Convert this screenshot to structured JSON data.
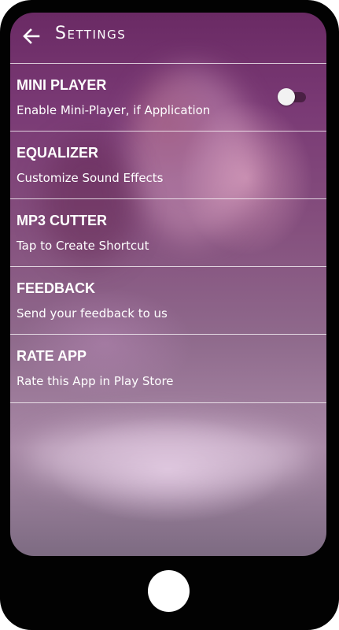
{
  "app_bar": {
    "title": "Settings",
    "back_icon": "arrow-left-icon"
  },
  "settings": [
    {
      "title": "MINI PLAYER",
      "subtitle": "Enable Mini-Player, if Application",
      "toggle": "off"
    },
    {
      "title": "EQUALIZER",
      "subtitle": "Customize Sound Effects"
    },
    {
      "title": "MP3 CUTTER",
      "subtitle": "Tap to Create Shortcut"
    },
    {
      "title": "FEEDBACK",
      "subtitle": "Send your feedback to us"
    },
    {
      "title": "RATE APP",
      "subtitle": "Rate this App in Play Store"
    }
  ],
  "colors": {
    "frame": "#020202",
    "background_tint": "#7a3a75",
    "text": "#ffffff",
    "divider": "#ffffff"
  }
}
